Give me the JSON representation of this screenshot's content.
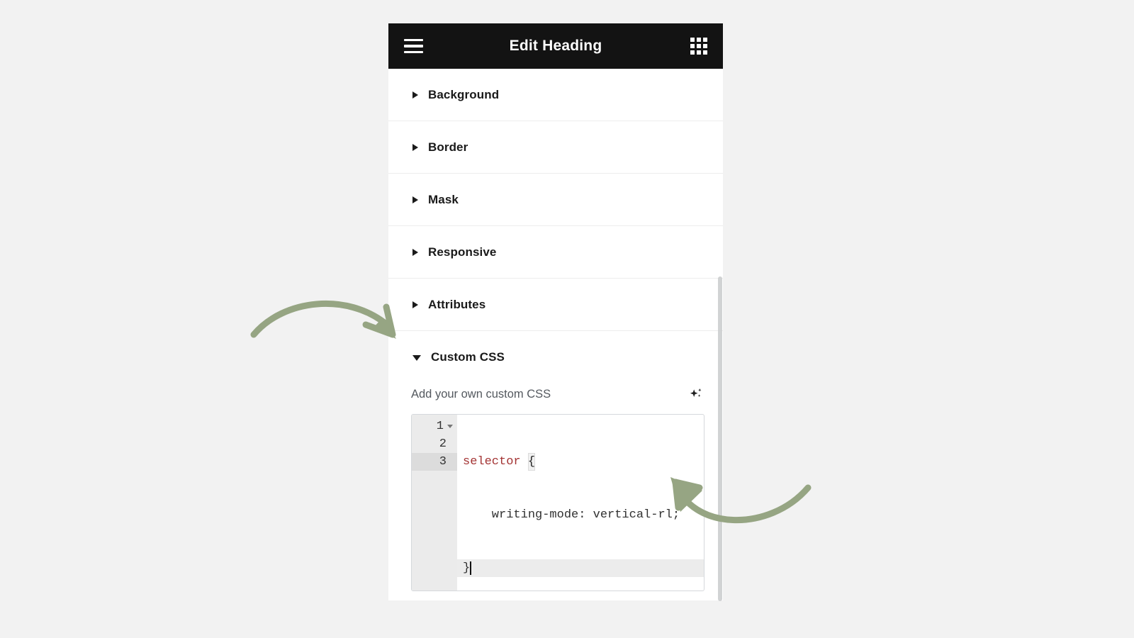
{
  "header": {
    "title": "Edit Heading",
    "menu_icon": "hamburger-menu-icon",
    "grid_icon": "app-grid-icon"
  },
  "sections": [
    {
      "label": "Background",
      "expanded": false,
      "icon": "triangle-right-icon"
    },
    {
      "label": "Border",
      "expanded": false,
      "icon": "triangle-right-icon"
    },
    {
      "label": "Mask",
      "expanded": false,
      "icon": "triangle-right-icon"
    },
    {
      "label": "Responsive",
      "expanded": false,
      "icon": "triangle-right-icon"
    },
    {
      "label": "Attributes",
      "expanded": false,
      "icon": "triangle-right-icon"
    },
    {
      "label": "Custom CSS",
      "expanded": true,
      "icon": "triangle-down-icon"
    }
  ],
  "custom_css": {
    "hint": "Add your own custom CSS",
    "ai_icon": "ai-sparkle-icon",
    "editor": {
      "lines": [
        {
          "number": "1",
          "text": "selector {",
          "active": false,
          "foldable": true
        },
        {
          "number": "2",
          "text": "    writing-mode: vertical-rl;",
          "active": false,
          "foldable": false
        },
        {
          "number": "3",
          "text": "}",
          "active": true,
          "foldable": false
        }
      ],
      "code_line1_selector": "selector",
      "code_line1_brace": "{",
      "code_line2": "    writing-mode: vertical-rl;",
      "code_line3": "}",
      "line_numbers": [
        "1",
        "2",
        "3"
      ]
    }
  },
  "annotations": [
    {
      "name": "arrow-to-custom-css",
      "color": "#96a583"
    },
    {
      "name": "arrow-to-code-editor",
      "color": "#96a583"
    }
  ],
  "colors": {
    "header_bg": "#131313",
    "page_bg": "#f2f2f2",
    "panel_bg": "#ffffff",
    "accent_arrow": "#96a583",
    "code_selector": "#a33333",
    "gutter_bg": "#ebebeb"
  }
}
